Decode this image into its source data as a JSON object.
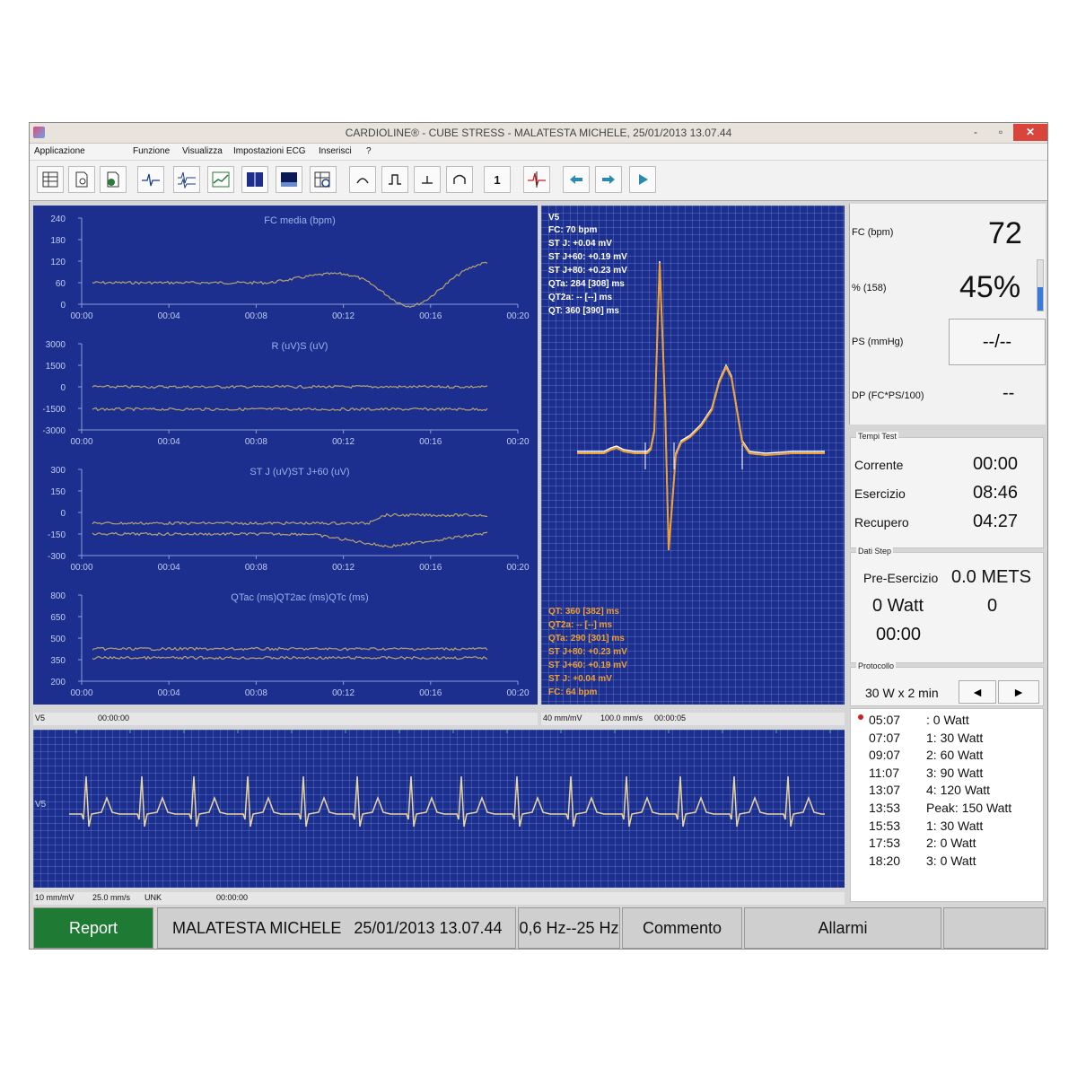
{
  "window": {
    "title": "CARDIOLINE® - CUBE STRESS - MALATESTA MICHELE, 25/01/2013 13.07.44",
    "minimize": "-",
    "maximize": "▫",
    "close": "✕"
  },
  "menu": [
    "Applicazione",
    "Funzione",
    "Visualizza",
    "Impostazioni ECG",
    "Inserisci",
    "?"
  ],
  "toolbar": {
    "icons": [
      "report-icon",
      "preview-icon",
      "export-icon",
      "ecg-single-icon",
      "ecg-multi-icon",
      "trend-icon",
      "layout-icon",
      "screen-icon",
      "zoom-grid-icon",
      "p-wave-icon",
      "pulse-icon",
      "baseline-icon",
      "wave-icon",
      "lead-one-icon",
      "marker-icon",
      "arrow-left-icon",
      "arrow-right-icon",
      "play-icon"
    ],
    "lead_button": "1"
  },
  "trends": {
    "charts": [
      {
        "title": "FC media (bpm)",
        "yticks": [
          "240",
          "180",
          "120",
          "60",
          "0"
        ]
      },
      {
        "title": "R (uV)S (uV)",
        "yticks": [
          "3000",
          "1500",
          "0",
          "-1500",
          "-3000"
        ]
      },
      {
        "title": "ST J (uV)ST J+60 (uV)",
        "yticks": [
          "300",
          "150",
          "0",
          "-150",
          "-300"
        ]
      },
      {
        "title": "QTac (ms)QT2ac (ms)QTc (ms)",
        "yticks": [
          "800",
          "650",
          "500",
          "350",
          "200"
        ]
      }
    ],
    "xticks": [
      "00:00",
      "00:04",
      "00:08",
      "00:12",
      "00:16",
      "00:20"
    ],
    "status": {
      "lead": "V5",
      "time": "00:00:00"
    }
  },
  "complex": {
    "lead": "V5",
    "current_lines": [
      "FC: 70 bpm",
      "ST J: +0.04 mV",
      "ST J+60: +0.19 mV",
      "ST J+80: +0.23 mV",
      "QTa: 284 [308] ms",
      "QT2a: -- [--] ms",
      "QT: 360 [390] ms"
    ],
    "ref_lines": [
      "QT: 360 [382] ms",
      "QT2a: -- [--] ms",
      "QTa: 290 [301] ms",
      "ST J+80: +0.23 mV",
      "ST J+60: +0.19 mV",
      "ST J: +0.04 mV",
      "FC: 64 bpm"
    ],
    "status": {
      "gain": "40 mm/mV",
      "speed": "100.0 mm/s",
      "time": "00:00:05"
    },
    "colors": {
      "current": "#ffffff",
      "reference": "#f0a030"
    }
  },
  "rhythm": {
    "lead": "V5",
    "status": {
      "gain": "10 mm/mV",
      "speed": "25.0 mm/s",
      "unk": "UNK",
      "time": "00:00:00"
    },
    "color": "#e8d6a0"
  },
  "vitals": {
    "fc_label": "FC (bpm)",
    "fc_value": "72",
    "pct_label": "% (158)",
    "pct_value": "45%",
    "ps_label": "PS (mmHg)",
    "ps_value": "--/--",
    "dp_label": "DP (FC*PS/100)",
    "dp_value": "--"
  },
  "tempi_test": {
    "title": "Tempi Test",
    "rows": [
      {
        "label": "Corrente",
        "value": "00:00"
      },
      {
        "label": "Esercizio",
        "value": "08:46"
      },
      {
        "label": "Recupero",
        "value": "04:27"
      }
    ]
  },
  "dati_step": {
    "title": "Dati Step",
    "phase": "Pre-Esercizio",
    "mets": "0.0 METS",
    "watt": "0 Watt",
    "count": "0",
    "time": "00:00"
  },
  "protocollo": {
    "title": "Protocollo",
    "name": "30 W x 2 min",
    "prev": "◄",
    "next": "►",
    "steps": [
      {
        "time": "05:07",
        "desc": ": 0 Watt"
      },
      {
        "time": "07:07",
        "desc": "1: 30 Watt"
      },
      {
        "time": "09:07",
        "desc": "2: 60 Watt"
      },
      {
        "time": "11:07",
        "desc": "3: 90 Watt"
      },
      {
        "time": "13:07",
        "desc": "4: 120 Watt"
      },
      {
        "time": "13:53",
        "desc": "Peak: 150 Watt"
      },
      {
        "time": "15:53",
        "desc": "1: 30 Watt"
      },
      {
        "time": "17:53",
        "desc": "2: 0 Watt"
      },
      {
        "time": "18:20",
        "desc": "3: 0 Watt"
      }
    ]
  },
  "footer": {
    "report": "Report",
    "patient": "MALATESTA MICHELE",
    "datetime": "25/01/2013 13.07.44",
    "filter": "0,6 Hz--25 Hz",
    "comment": "Commento",
    "alarms": "Allarmi",
    "report_color": "#1f7a34"
  }
}
